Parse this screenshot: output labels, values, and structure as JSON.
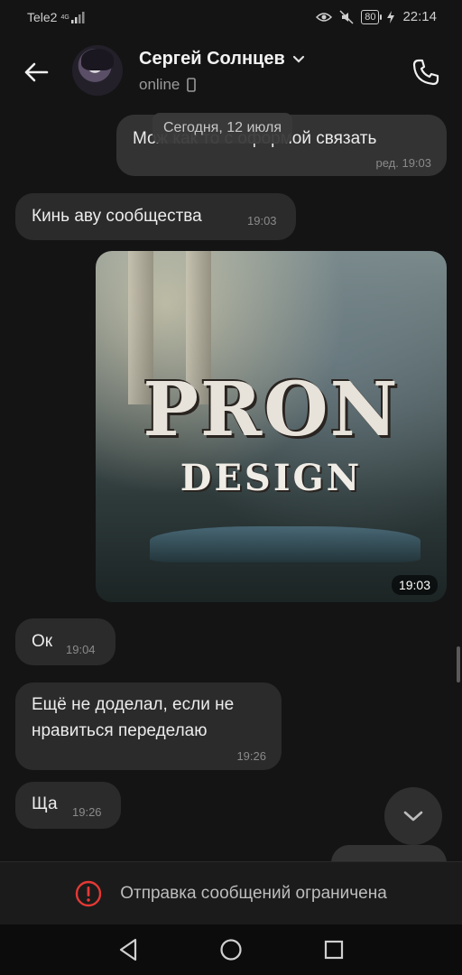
{
  "status_bar": {
    "carrier": "Tele2",
    "network": "4G",
    "battery": "80",
    "time": "22:14"
  },
  "header": {
    "contact_name": "Сергей Солнцев",
    "contact_status": "online"
  },
  "chat": {
    "date_separator": "Сегодня, 12 июля",
    "messages": [
      {
        "direction": "out",
        "text": "Мож как то с оформой связать",
        "meta": "ред. 19:03"
      },
      {
        "direction": "in",
        "text": "Кинь аву сообщества",
        "time": "19:03"
      },
      {
        "direction": "out",
        "type": "image",
        "image_text_main": "PRON",
        "image_text_sub": "DESIGN",
        "time": "19:03"
      },
      {
        "direction": "in",
        "text": "Ок",
        "time": "19:04"
      },
      {
        "direction": "in",
        "text_line1": "Ещё не доделал, если не",
        "text_line2": "нравиться переделаю",
        "time": "19:26"
      },
      {
        "direction": "in",
        "text": "Ща",
        "time": "19:26"
      }
    ]
  },
  "restricted": {
    "text": "Отправка сообщений ограничена"
  },
  "icons": {
    "back": "arrow-left-icon",
    "call": "phone-icon",
    "scroll_down": "chevron-down-icon",
    "warning": "exclamation-circle-icon"
  },
  "colors": {
    "background": "#141414",
    "bubble_in": "#2b2b2b",
    "bubble_out": "#333333",
    "warning": "#e53935"
  }
}
